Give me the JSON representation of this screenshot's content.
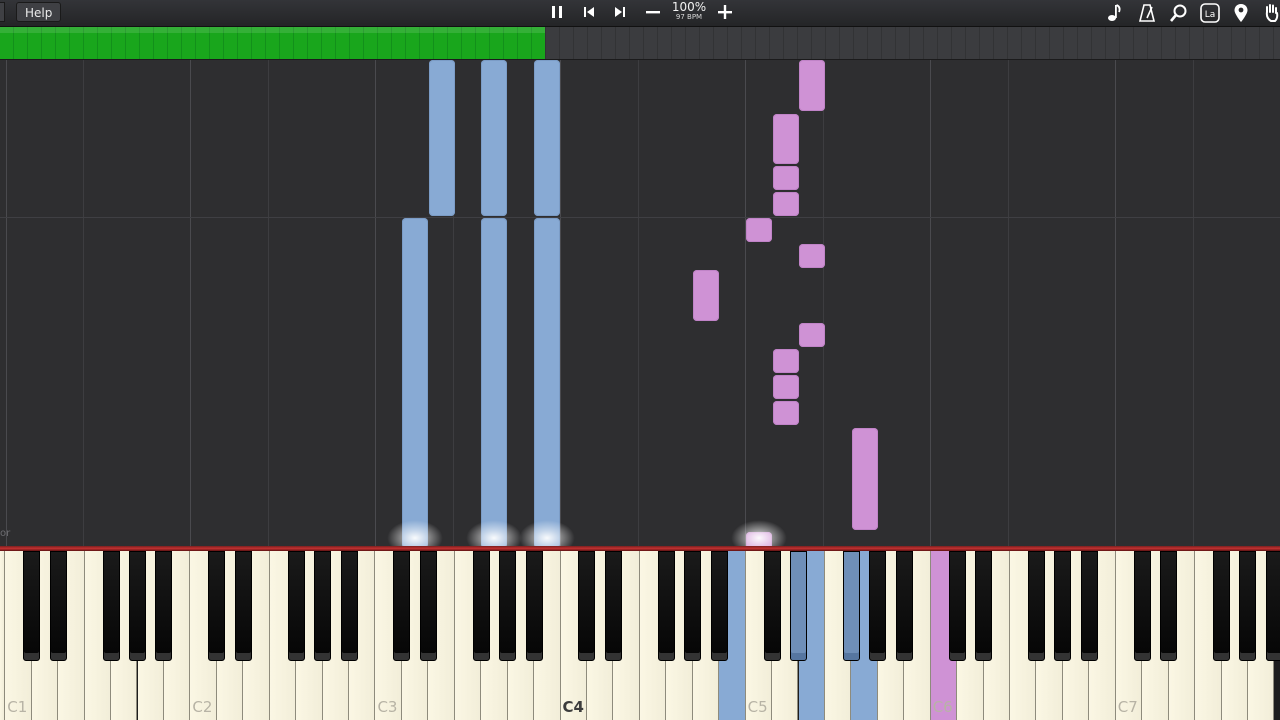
{
  "toolbar": {
    "help_label": "Help",
    "speed_percent": "100%",
    "bpm_label": "97 BPM",
    "icons": [
      "pause-icon",
      "skip-back-icon",
      "skip-forward-icon",
      "minus-icon",
      "plus-icon",
      "music-note-icon",
      "metronome-icon",
      "search-icon",
      "label-icon",
      "location-pin-icon",
      "hand-icon"
    ],
    "label_icon_text": "La"
  },
  "progress": {
    "fraction": 0.426,
    "fill_color": "#19a61c"
  },
  "roll": {
    "corner_label": "or",
    "colors": {
      "left_hand": "#88aad4",
      "right_hand": "#cf92d5",
      "background": "#2e2e30"
    }
  },
  "keyboard": {
    "first_note": "C1",
    "octave_labels": [
      "C1",
      "C2",
      "C3",
      "C4",
      "C5",
      "C6",
      "C7"
    ],
    "highlighted_label": "C4"
  }
}
